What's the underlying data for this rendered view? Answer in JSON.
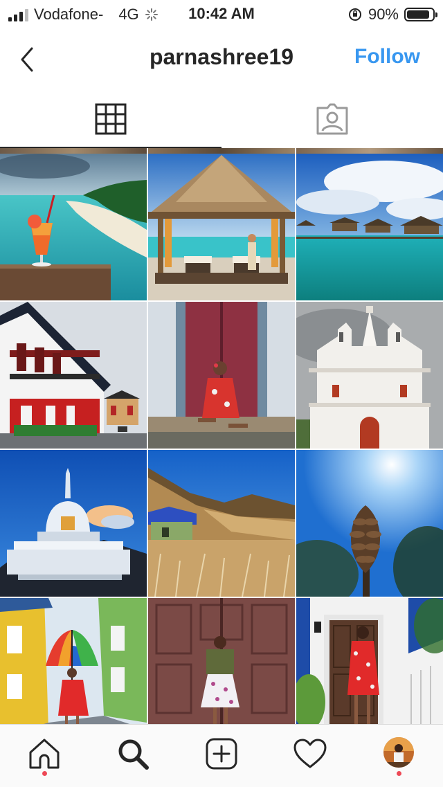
{
  "status_bar": {
    "carrier": "Vodafone-",
    "network": "4G",
    "time": "10:42 AM",
    "battery": "90%",
    "battery_level": 0.9
  },
  "header": {
    "username": "parnashree19",
    "follow_label": "Follow"
  },
  "tabs": [
    {
      "name": "grid",
      "icon": "grid-icon",
      "selected": true
    },
    {
      "name": "tagged",
      "icon": "tagged-user-icon",
      "selected": false
    }
  ],
  "posts": [
    {
      "subject": "tropical beach with orange cocktail"
    },
    {
      "subject": "thatched beach hut with massage tables"
    },
    {
      "subject": "overwater villas in turquoise lagoon"
    },
    {
      "subject": "red and white colonial house"
    },
    {
      "subject": "woman in red dress at pink door"
    },
    {
      "subject": "white baroque church facade"
    },
    {
      "subject": "white peace pagoda at dusk"
    },
    {
      "subject": "blue-roofed hut on golden hills"
    },
    {
      "subject": "pine cone against blue sky"
    },
    {
      "subject": "woman with rainbow umbrella in street"
    },
    {
      "subject": "woman in floral dress at wooden door"
    },
    {
      "subject": "woman in red dress at blue house door"
    }
  ],
  "bottom_nav": [
    {
      "name": "home",
      "icon": "home-icon",
      "notification_dot": true
    },
    {
      "name": "search",
      "icon": "search-icon",
      "notification_dot": false
    },
    {
      "name": "new-post",
      "icon": "add-post-icon",
      "notification_dot": false
    },
    {
      "name": "activity",
      "icon": "heart-icon",
      "notification_dot": false
    },
    {
      "name": "profile",
      "icon": "profile-avatar",
      "notification_dot": true
    }
  ],
  "colors": {
    "follow_blue": "#3897f0",
    "notification_red": "#ed4956",
    "text_dark": "#262626"
  }
}
